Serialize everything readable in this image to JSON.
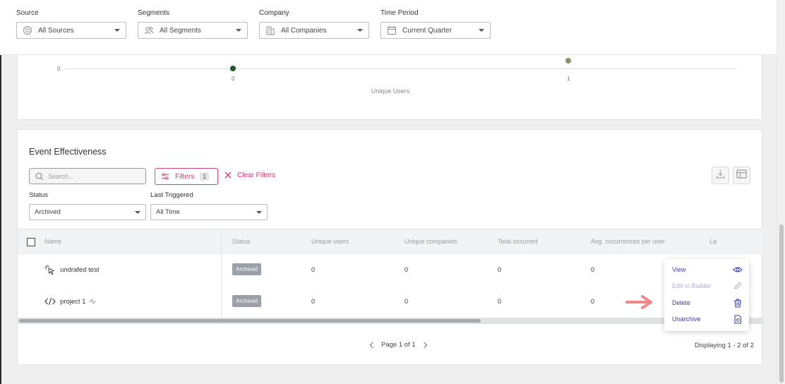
{
  "filters": {
    "source": {
      "label": "Source",
      "value": "All Sources"
    },
    "segments": {
      "label": "Segments",
      "value": "All Segments"
    },
    "company": {
      "label": "Company",
      "value": "All Companies"
    },
    "time_period": {
      "label": "Time Period",
      "value": "Current Quarter"
    }
  },
  "chart": {
    "y_tick": "0",
    "x_ticks": [
      "0",
      "1"
    ],
    "x_axis_label": "Unique Users",
    "points": [
      {
        "x": 0,
        "color": "#1e5a23"
      },
      {
        "x": 1,
        "color": "#8f8f6a"
      }
    ]
  },
  "event_card": {
    "title": "Event Effectiveness",
    "search_placeholder": "Search...",
    "filters_label": "Filters",
    "filters_count": "1",
    "clear_filters_label": "Clear Filters",
    "status_label": "Status",
    "status_value": "Archived",
    "last_triggered_label": "Last Triggered",
    "last_triggered_value": "All Time"
  },
  "table": {
    "columns": [
      "Name",
      "Status",
      "Unique users",
      "Unique companies",
      "Total occurred",
      "Avg. occurrences per user",
      "La"
    ],
    "rows": [
      {
        "name": "undrafed test",
        "status": "Archived",
        "unique_users": "0",
        "unique_companies": "0",
        "total_occurred": "0",
        "avg_per_user": "0"
      },
      {
        "name": "project 1",
        "status": "Archived",
        "unique_users": "0",
        "unique_companies": "0",
        "total_occurred": "0",
        "avg_per_user": "0"
      }
    ]
  },
  "pagination": {
    "page_text": "Page 1 of 1",
    "displaying_text": "Displaying 1 - 2 of 2"
  },
  "context_menu": {
    "items": [
      {
        "label": "View",
        "icon": "eye-icon",
        "disabled": false
      },
      {
        "label": "Edit in Builder",
        "icon": "pencil-icon",
        "disabled": true
      },
      {
        "label": "Delete",
        "icon": "trash-icon",
        "disabled": false
      },
      {
        "label": "Unarchive",
        "icon": "unarchive-icon",
        "disabled": false
      }
    ]
  },
  "colors": {
    "accent_pink": "#d63a6e",
    "menu_text": "#3d3fb0",
    "badge_gray": "#9aa0a6",
    "arrow": "#f0888a"
  }
}
